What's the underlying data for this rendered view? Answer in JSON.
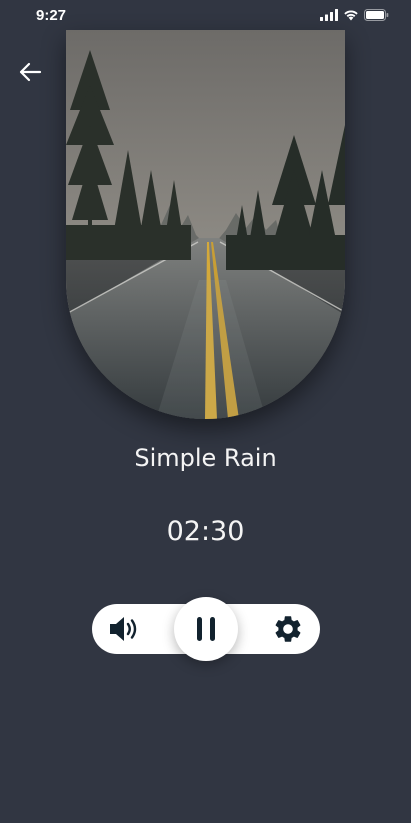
{
  "status_bar": {
    "time": "9:27",
    "icons": [
      "cellular-signal-icon",
      "wifi-icon",
      "battery-icon"
    ]
  },
  "header": {
    "back_icon": "arrow-left-icon"
  },
  "player": {
    "cover_image": "misty-rainy-road-with-pine-trees",
    "title": "Simple Rain",
    "time_remaining": "02:30"
  },
  "controls": {
    "volume_icon": "volume-icon",
    "pause_icon": "pause-icon",
    "settings_icon": "gear-icon"
  },
  "colors": {
    "background": "#313642",
    "controls_bg": "#ffffff",
    "icon_dark": "#12222e",
    "text": "#f4f4f4"
  }
}
